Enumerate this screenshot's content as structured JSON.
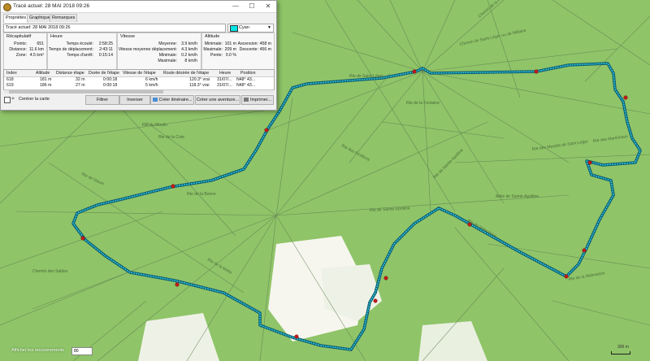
{
  "window": {
    "title": "Tracé actuel: 28 MAI 2018 09:26",
    "controls": {
      "minimize": "—",
      "maximize": "☐",
      "close": "✕"
    }
  },
  "tabs": [
    {
      "label": "Propriétés",
      "active": true
    },
    {
      "label": "Graphique",
      "active": false
    },
    {
      "label": "Remarques",
      "active": false
    }
  ],
  "track_name": "Tracé actuel: 28 MAI 2018 09:26",
  "color": {
    "label": "Cyan",
    "value": "#00e5e5"
  },
  "summary": {
    "title": "Récapitulatif",
    "rows": [
      {
        "label": "Points:",
        "value": "651"
      },
      {
        "label": "Distance:",
        "value": "11.6 km"
      },
      {
        "label": "Zone:",
        "value": "4.5 km²"
      }
    ]
  },
  "time": {
    "title": "Heure",
    "rows": [
      {
        "label": "Temps écoulé:",
        "value": "2:58:25"
      },
      {
        "label": "Temps de déplacement:",
        "value": "2:43:11"
      },
      {
        "label": "Temps d'arrêt:",
        "value": "0:15:14"
      }
    ]
  },
  "speed": {
    "title": "Vitesse",
    "rows": [
      {
        "label": "Moyenne:",
        "value": "3.9 km/h"
      },
      {
        "label": "Vitesse moyenne déplacement:",
        "value": "4.3 km/h"
      },
      {
        "label": "Minimale:",
        "value": "0.2 km/h"
      },
      {
        "label": "Maximale:",
        "value": "8 km/h"
      }
    ]
  },
  "altitude": {
    "title": "Altitude",
    "rows": [
      {
        "label": "Minimale:",
        "value": "101 m",
        "label2": "Ascension:",
        "value2": "458 m"
      },
      {
        "label": "Maximale:",
        "value": "209 m",
        "label2": "Descente:",
        "value2": "456 m"
      },
      {
        "label": "Pente:",
        "value": "0.0 %",
        "label2": "",
        "value2": ""
      }
    ]
  },
  "list": {
    "columns": [
      "Index",
      "Altitude",
      "Distance étape",
      "Durée de l'étape",
      "Vitesse de l'étape",
      "Route désirée de l'étape",
      "Heure",
      "Position"
    ],
    "rows": [
      [
        "618",
        "181 m",
        "32 m",
        "0:00:18",
        "6 km/h",
        "120.3° vrai",
        "31/07/...",
        "N48° 43..."
      ],
      [
        "619",
        "186 m",
        "27 m",
        "0:00:18",
        "5 km/h",
        "118.3° vrai",
        "31/07/...",
        "N48° 43..."
      ]
    ]
  },
  "bottom": {
    "center_map": "Centrer la carte",
    "filter": "Filtrer",
    "reverse": "Inverser",
    "create_route": "Créer itinéraire...",
    "create_activity": "Créer une aventure...",
    "print": "Imprimer..."
  },
  "status": {
    "show_overlays": "Afficher les recouvrements",
    "zoom": "80",
    "scale": "300 m"
  },
  "map_labels": [
    "Chemin de Saint-Léger ou de Millaise",
    "Chemin de la Roche",
    "Rte de Saint-Léger",
    "Rte des Maréchaux",
    "Rte de la Cote",
    "Rte du Moulin",
    "Rte de Sainte-Apolline",
    "Allée de Sainte-Apolline",
    "Rte des Mesnils de Saint-Léger",
    "Rte de la Bonne",
    "Rte de Gaure",
    "Rte de la Malmaison",
    "Rte de Malmaison",
    "Rte de la Motte",
    "Chemin des Sables",
    "Rte de la Fontaine",
    "Rte des Pavillons",
    "Rte de Sainte-Apolline"
  ]
}
